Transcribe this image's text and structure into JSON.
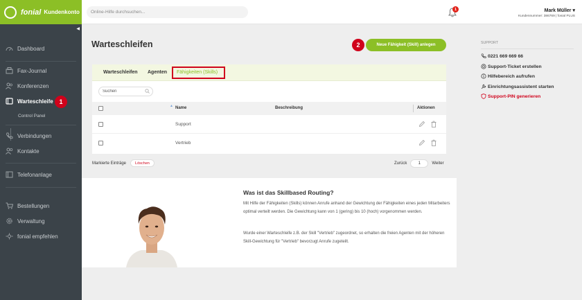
{
  "brand": {
    "name": "fonial",
    "product": "Kundenkonto"
  },
  "search": {
    "placeholder": "Online-Hilfe durchsuchen..."
  },
  "notifications": {
    "count": "1"
  },
  "user": {
    "name": "Mark Müller",
    "details": "Kundennummer: 386769 | fonial PLUS"
  },
  "sidebar": {
    "items": [
      {
        "label": "Dashboard",
        "icon": "speedometer-icon"
      },
      {
        "label": "Fax-Journal",
        "icon": "fax-icon"
      },
      {
        "label": "Konferenzen",
        "icon": "people-icon"
      },
      {
        "label": "Warteschleife",
        "icon": "queue-icon"
      },
      {
        "label": "Verbindungen",
        "icon": "phone-icon"
      },
      {
        "label": "Kontakte",
        "icon": "contacts-icon"
      },
      {
        "label": "Telefonanlage",
        "icon": "pbx-icon"
      },
      {
        "label": "Bestellungen",
        "icon": "cart-icon"
      },
      {
        "label": "Verwaltung",
        "icon": "gear-icon"
      },
      {
        "label": "fonial empfehlen",
        "icon": "recommend-icon"
      }
    ],
    "sub_item": "Control Panel",
    "active": "Warteschleife"
  },
  "annotations": {
    "step1": "1",
    "step2": "2"
  },
  "page": {
    "title": "Warteschleifen",
    "new_button": "Neue Fähigkeit (Skill) anlegen"
  },
  "tabs": [
    "Warteschleifen",
    "Agenten",
    "Fähigkeiten (Skills)"
  ],
  "table": {
    "search_placeholder": "Suchen",
    "columns": {
      "name": "Name",
      "description": "Beschreibung",
      "actions": "Aktionen"
    },
    "rows": [
      {
        "name": "Support",
        "description": ""
      },
      {
        "name": "Vertrieb",
        "description": ""
      }
    ]
  },
  "bulk": {
    "label": "Markierte Einträge",
    "delete": "Löschen"
  },
  "pager": {
    "prev": "Zurück",
    "page": "1",
    "next": "Weiter"
  },
  "info": {
    "title": "Was ist das Skillbased Routing?",
    "p1": "Mit Hilfe der Fähigkeiten (Skills) können Anrufe anhand der Gewichtung der Fähigkeiten eines jeden Mitarbeiters optimal verteilt werden. Die Gewichtung kann von 1 (gering) bis 10 (hoch) vorgenommen werden.",
    "p2": "Wurde einer Warteschleife z.B. der Skill \"Vertrieb\" zugeordnet, so erhalten die freien Agenten mit der höheren Skill-Gewichtung für \"Vertrieb\" bevorzugt Anrufe zugeteilt."
  },
  "support": {
    "header": "SUPPORT",
    "phone": "0221 669 669 66",
    "ticket": "Support-Ticket erstellen",
    "help": "Hilfebereich aufrufen",
    "wizard": "Einrichtungsassistent starten",
    "pin": "Support-PIN generieren"
  },
  "colors": {
    "brand": "#8cbf26",
    "sidebar": "#3b4349",
    "alert": "#d0021b"
  }
}
